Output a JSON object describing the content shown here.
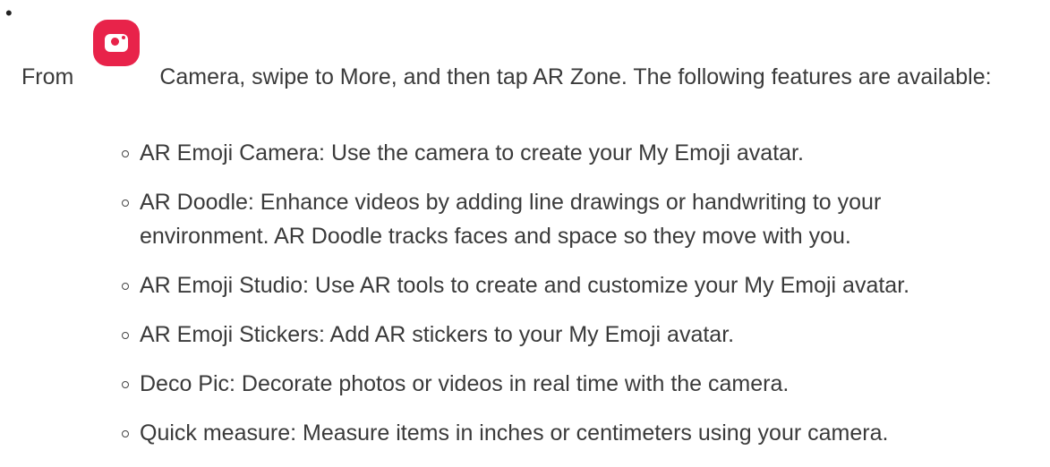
{
  "bullet": "•",
  "intro": {
    "before_icon": "From",
    "app_name": "Camera",
    "after_icon": ", swipe to More, and then tap AR Zone. The following features are available:",
    "icon": "camera-app-icon",
    "icon_color": "#e8234a"
  },
  "features": [
    {
      "text": "AR Emoji Camera: Use the camera to create your My Emoji avatar."
    },
    {
      "text": "AR Doodle: Enhance videos by adding line drawings or handwriting to your environment. AR Doodle tracks faces and space so they move with you."
    },
    {
      "text": "AR Emoji Studio: Use AR tools to create and customize your My Emoji avatar."
    },
    {
      "text": "AR Emoji Stickers: Add AR stickers to your My Emoji avatar."
    },
    {
      "text": "Deco Pic: Decorate photos or videos in real time with the camera."
    },
    {
      "text": "Quick measure: Measure items in inches or centimeters using your camera."
    }
  ]
}
